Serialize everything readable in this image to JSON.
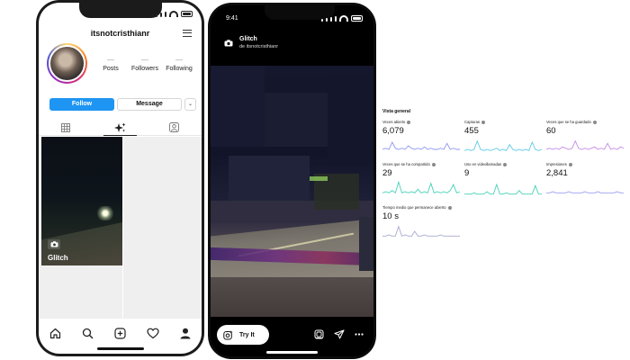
{
  "profile_phone": {
    "username": "itsnotcristhianr",
    "stats": [
      {
        "value": "—",
        "label": "Posts"
      },
      {
        "value": "—",
        "label": "Followers"
      },
      {
        "value": "—",
        "label": "Following"
      }
    ],
    "follow_label": "Follow",
    "message_label": "Message",
    "dropdown_glyph": "⌄",
    "tabs": [
      "grid-icon",
      "effects-icon",
      "tagged-icon"
    ],
    "grid_item_label": "Glitch",
    "nav": [
      "home-icon",
      "search-icon",
      "create-icon",
      "heart-icon",
      "profile-icon"
    ]
  },
  "story_phone": {
    "time": "9:41",
    "effect_title": "Glitch",
    "effect_creator": "de itsnotcristhianr",
    "try_it_label": "Try It",
    "actions": [
      "save-effect-icon",
      "send-icon",
      "more-icon"
    ]
  },
  "insights": {
    "title": "Vista general",
    "metrics": [
      {
        "label": "Veces abierto",
        "value": "6,079",
        "color": "#8e97f2"
      },
      {
        "label": "Capturas",
        "value": "455",
        "color": "#5bc8e8"
      },
      {
        "label": "Veces que se ha guardado",
        "value": "60",
        "color": "#c58ae8"
      },
      {
        "label": "Veces que se ha compartido",
        "value": "29",
        "color": "#46d1b6"
      },
      {
        "label": "Uso en videollamadas",
        "value": "9",
        "color": "#46d1b6"
      },
      {
        "label": "Impresiones",
        "value": "2,841",
        "color": "#9b9df0"
      },
      {
        "label": "Tiempo medio que permanece abierto",
        "value": "10 s",
        "color": "#a9a9d0"
      }
    ]
  }
}
